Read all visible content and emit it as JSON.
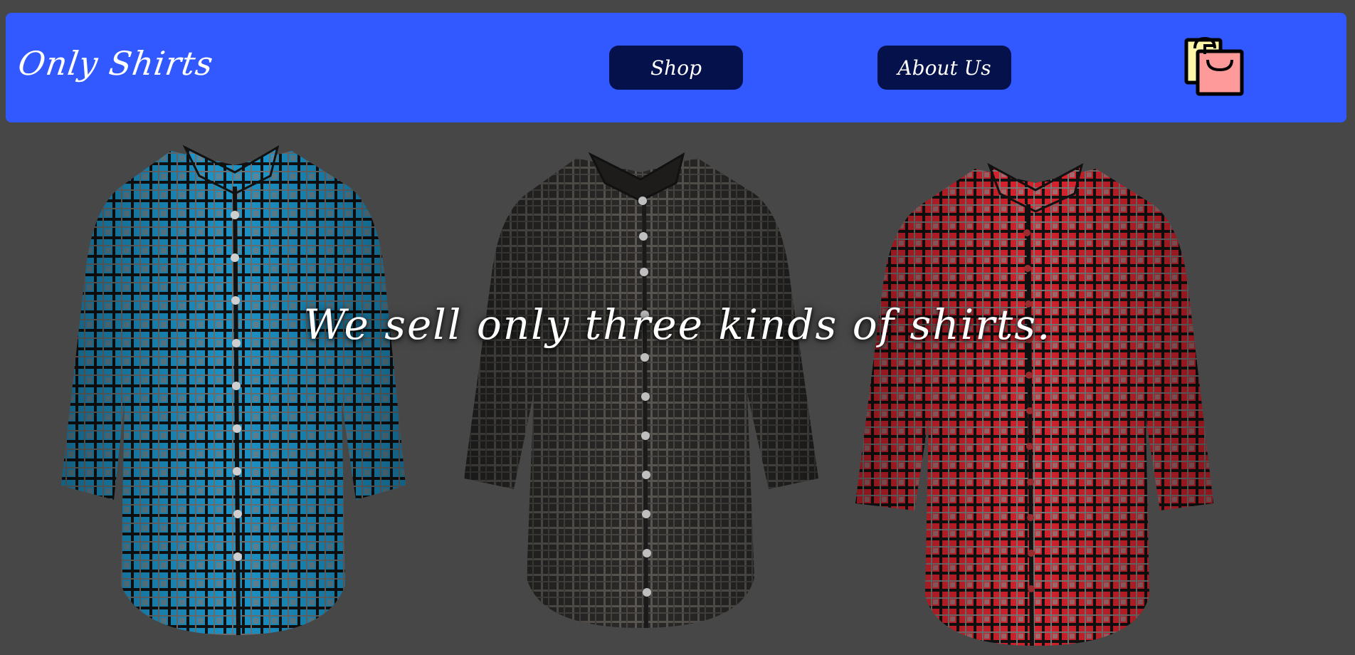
{
  "header": {
    "brand": "Only Shirts",
    "shop_label": "Shop",
    "about_label": "About Us",
    "cart_icon": "shopping-bags-icon"
  },
  "hero": {
    "tagline": "We sell only three kinds of shirts."
  },
  "shirts": [
    {
      "name": "blue plaid shirt",
      "color": "#1a8fc4"
    },
    {
      "name": "black plaid shirt",
      "color": "#3a3a3a"
    },
    {
      "name": "red plaid shirt",
      "color": "#d7262e"
    }
  ],
  "colors": {
    "background": "#474747",
    "navbar": "#3259ff",
    "button": "#04114a",
    "text": "#ffffff"
  }
}
